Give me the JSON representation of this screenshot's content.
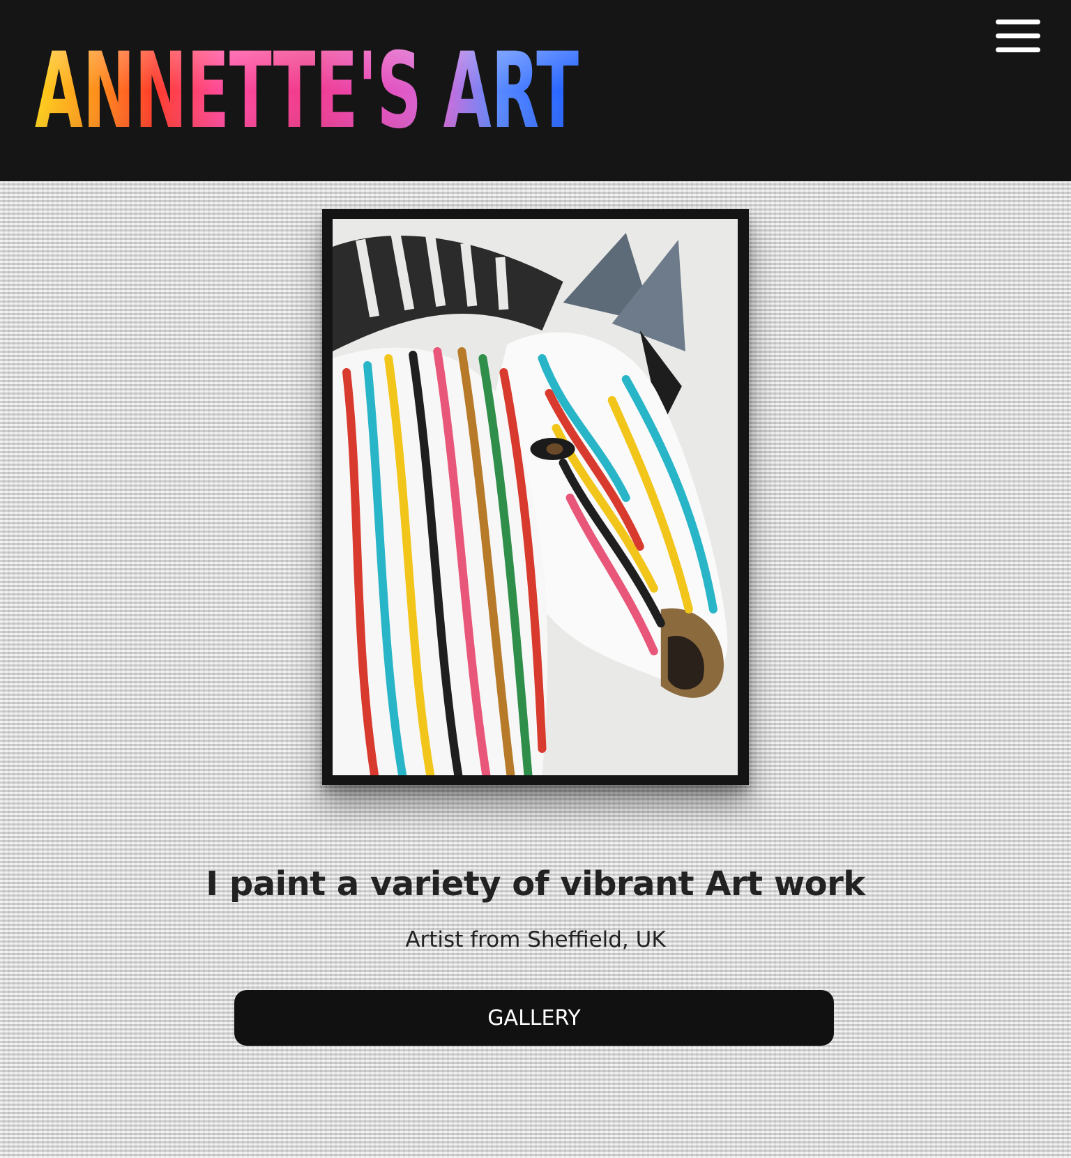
{
  "header": {
    "logo_text": "ANNETTE'S ART",
    "menu_icon": "hamburger-menu-icon",
    "background": "#151515"
  },
  "hero": {
    "image_icon": "zebra-painting",
    "headline": "I paint a variety of vibrant Art work",
    "subline": "Artist from Sheffield, UK",
    "cta_label": "GALLERY"
  },
  "colors": {
    "button_bg": "#111111",
    "button_text": "#ffffff",
    "text": "#222222"
  }
}
